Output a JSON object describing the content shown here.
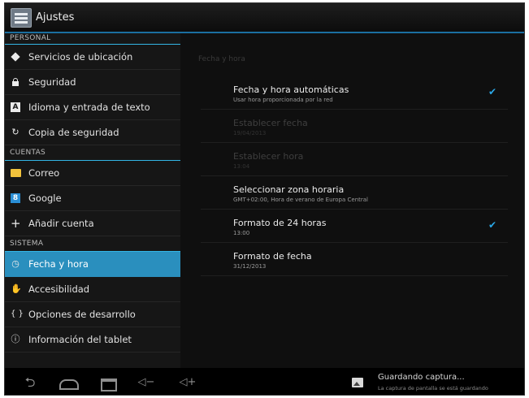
{
  "actionbar": {
    "title": "Ajustes",
    "icon": "settings-app-icon"
  },
  "sidebar": {
    "sections": {
      "personal": "PERSONAL",
      "cuentas": "CUENTAS",
      "sistema": "SISTEMA"
    },
    "personal_items": [
      {
        "label": "Servicios de ubicación",
        "icon": "location-icon"
      },
      {
        "label": "Seguridad",
        "icon": "lock-icon"
      },
      {
        "label": "Idioma y entrada de texto",
        "icon": "language-icon"
      },
      {
        "label": "Copia de seguridad",
        "icon": "backup-icon"
      }
    ],
    "cuentas_items": [
      {
        "label": "Correo",
        "icon": "mail-icon"
      },
      {
        "label": "Google",
        "icon": "google-icon"
      },
      {
        "label": "Añadir cuenta",
        "icon": "add-icon"
      }
    ],
    "sistema_items": [
      {
        "label": "Fecha y hora",
        "icon": "clock-icon",
        "selected": true
      },
      {
        "label": "Accesibilidad",
        "icon": "accessibility-icon"
      },
      {
        "label": "Opciones de desarrollo",
        "icon": "developer-icon"
      },
      {
        "label": "Información del tablet",
        "icon": "info-icon"
      }
    ],
    "accent_color": "#2a8fbe"
  },
  "detail": {
    "header": "Fecha y hora",
    "rows": [
      {
        "title": "Fecha y hora automáticas",
        "sub": "Usar hora proporcionada por la red",
        "checked": true,
        "enabled": true
      },
      {
        "title": "Establecer fecha",
        "sub": "19/04/2013",
        "enabled": false
      },
      {
        "title": "Establecer hora",
        "sub": "13:04",
        "enabled": false
      },
      {
        "title": "Seleccionar zona horaria",
        "sub": "GMT+02:00, Hora de verano de Europa Central",
        "enabled": true
      },
      {
        "title": "Formato de 24 horas",
        "sub": "13:00",
        "checked": true,
        "enabled": true
      },
      {
        "title": "Formato de fecha",
        "sub": "31/12/2013",
        "enabled": true
      }
    ],
    "check_color": "#2aa7e6"
  },
  "navbar": {
    "buttons": [
      "back-icon",
      "home-icon",
      "recent-apps-icon",
      "volume-down-icon",
      "volume-up-icon"
    ],
    "notification": {
      "title": "Guardando captura...",
      "subtitle": "La captura de pantalla se está guardando",
      "icon": "image-icon"
    }
  }
}
